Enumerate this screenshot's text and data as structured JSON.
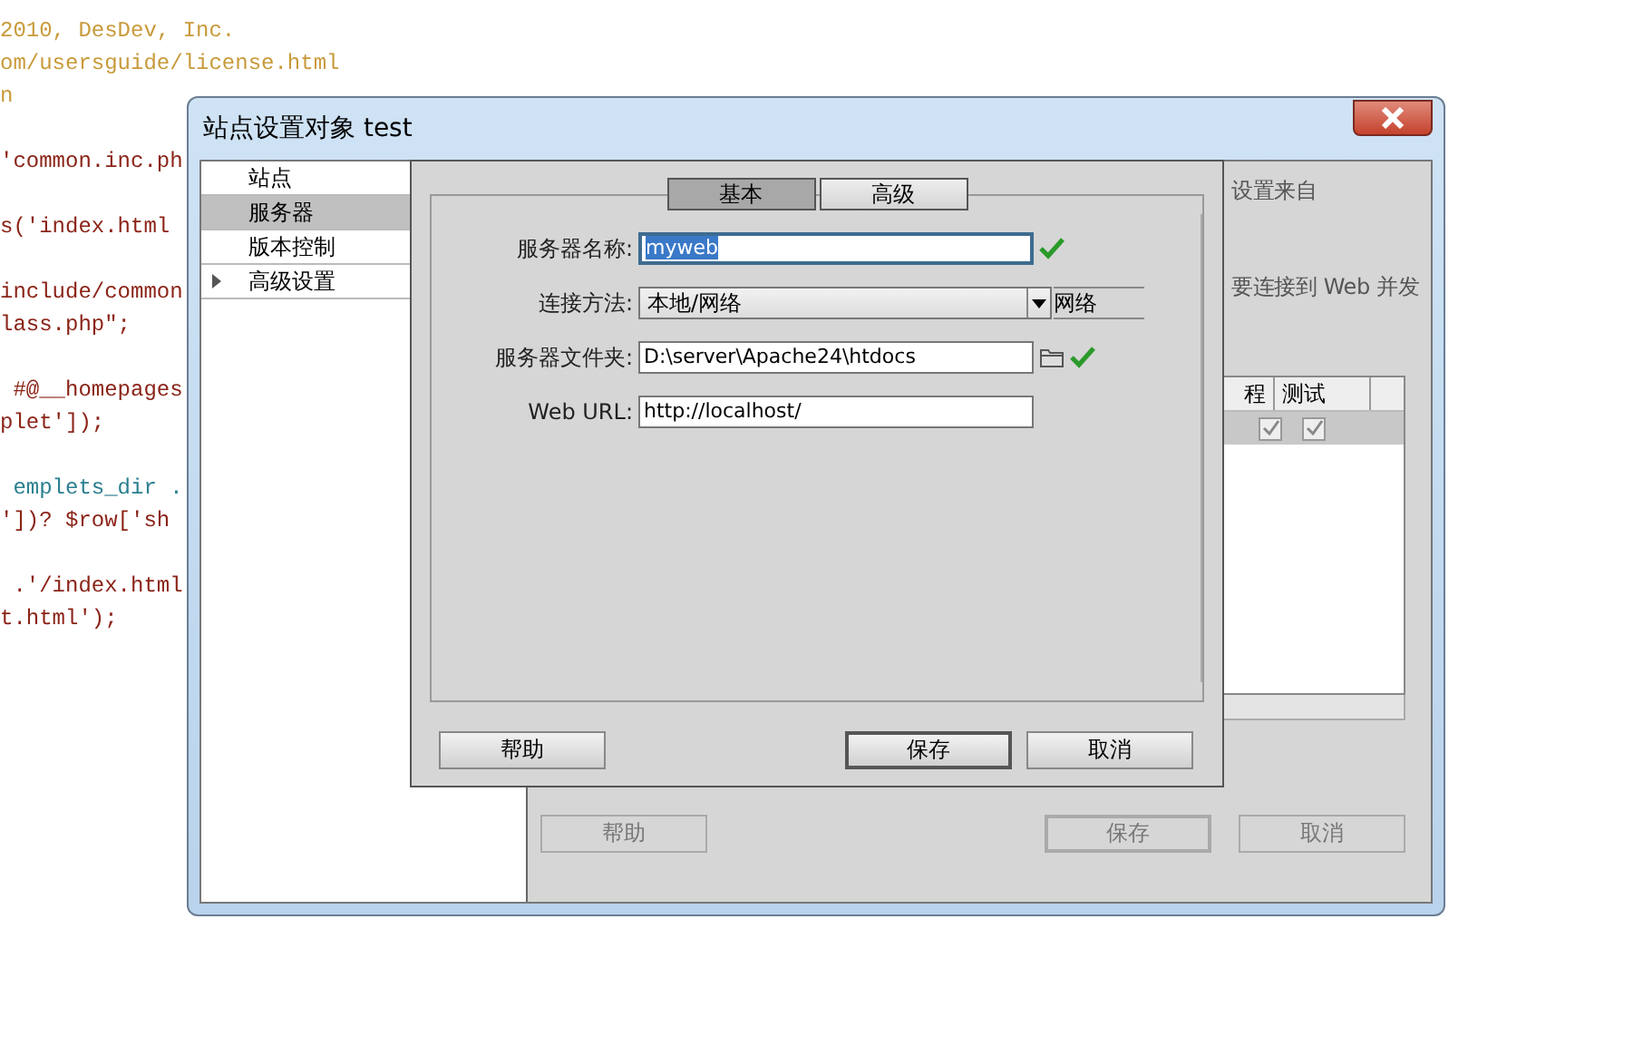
{
  "editor": {
    "blocks": [
      [
        {
          "kind": "comment",
          "text": "2010, DesDev, Inc."
        },
        {
          "kind": "comment",
          "text": "om/usersguide/license.html"
        },
        {
          "kind": "comment",
          "text": "n"
        }
      ],
      [
        {
          "kind": "code",
          "text": "'common.inc.ph"
        }
      ],
      [
        {
          "kind": "code",
          "text": "s('index.html"
        }
      ],
      [
        {
          "kind": "code",
          "text": "include/common"
        },
        {
          "kind": "code",
          "text": "lass.php\";"
        }
      ],
      [
        {
          "kind": "code",
          "text": " #@__homepages"
        },
        {
          "kind": "code",
          "text": "plet']);"
        }
      ],
      [
        {
          "kind": "identifier",
          "text": " emplets_dir ."
        },
        {
          "kind": "code",
          "text": "'])? $row['sh"
        }
      ],
      [
        {
          "kind": "code",
          "text": " .'/index.html"
        },
        {
          "kind": "code",
          "text": "t.html');"
        }
      ]
    ]
  },
  "window": {
    "title": "站点设置对象 test",
    "sidebar": {
      "items": [
        {
          "label": "站点",
          "selected": false,
          "expandable": false
        },
        {
          "label": "服务器",
          "selected": true,
          "expandable": false
        },
        {
          "label": "版本控制",
          "selected": false,
          "expandable": false
        },
        {
          "label": "高级设置",
          "selected": false,
          "expandable": true,
          "expanded": false
        }
      ]
    },
    "panel": {
      "texts": [
        "设置来自",
        "要连接到 Web 并发"
      ],
      "table": {
        "columns": [
          "程",
          "测试"
        ],
        "rows": [
          [
            {
              "checked": true
            },
            {
              "checked": true
            }
          ]
        ]
      },
      "buttons": [
        {
          "label": "帮助",
          "disabled": true,
          "default": false
        },
        {
          "label": "保存",
          "disabled": true,
          "default": true
        },
        {
          "label": "取消",
          "disabled": true,
          "default": false
        }
      ]
    }
  },
  "dialog": {
    "tabs": [
      {
        "label": "基本",
        "selected": true
      },
      {
        "label": "高级",
        "selected": false
      }
    ],
    "fields": [
      {
        "kind": "text",
        "label": "服务器名称:",
        "value": "myweb",
        "highlighted": true,
        "valid": true
      },
      {
        "kind": "select",
        "label": "连接方法:",
        "value": "本地/网络",
        "trailing": "网络"
      },
      {
        "kind": "folder",
        "label": "服务器文件夹:",
        "value": "D:\\server\\Apache24\\htdocs",
        "valid": true
      },
      {
        "kind": "text",
        "label": "Web URL:",
        "value": "http://localhost/",
        "highlighted": false
      }
    ],
    "buttons": [
      {
        "label": "帮助",
        "disabled": false,
        "default": false
      },
      {
        "label": "保存",
        "disabled": false,
        "default": true
      },
      {
        "label": "取消",
        "disabled": false,
        "default": false
      }
    ]
  }
}
